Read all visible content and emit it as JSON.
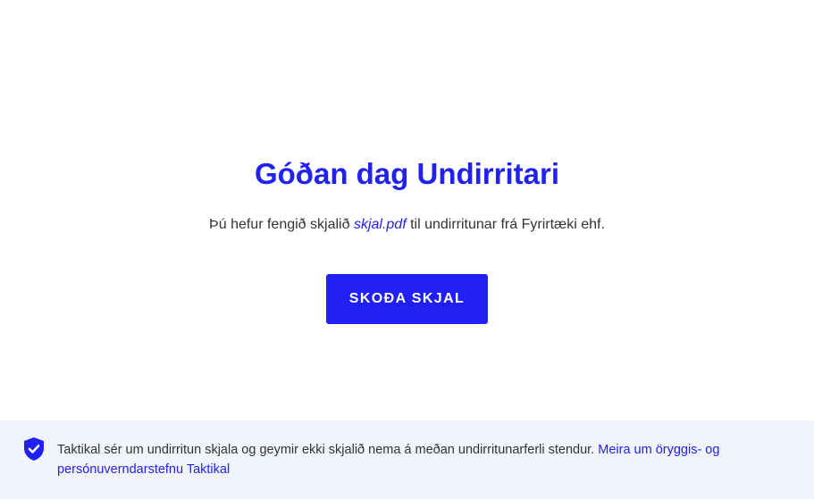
{
  "main": {
    "greeting": "Góðan dag Undirritari",
    "message_prefix": "Þú hefur fengið skjalið",
    "document_name": "skjal.pdf",
    "message_suffix": "til undirritunar frá Fyrirtæki ehf.",
    "view_button_label": "SKOÐA SKJAL"
  },
  "footer": {
    "icon": "shield-check-icon",
    "notice": "Taktikal sér um undirritun skjala og geymir ekki skjalið nema á meðan undirritunarferli stendur.",
    "link_label": "Meira um öryggis- og persónuverndarstefnu Taktikal"
  },
  "colors": {
    "accent": "#2020f2",
    "footer_background": "#f1f4fb",
    "text": "#333333"
  }
}
